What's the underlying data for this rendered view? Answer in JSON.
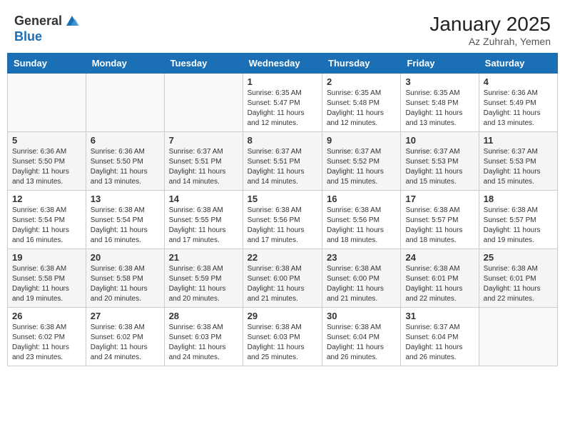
{
  "header": {
    "logo_general": "General",
    "logo_blue": "Blue",
    "month_title": "January 2025",
    "location": "Az Zuhrah, Yemen"
  },
  "days_of_week": [
    "Sunday",
    "Monday",
    "Tuesday",
    "Wednesday",
    "Thursday",
    "Friday",
    "Saturday"
  ],
  "weeks": [
    [
      {
        "day": "",
        "info": ""
      },
      {
        "day": "",
        "info": ""
      },
      {
        "day": "",
        "info": ""
      },
      {
        "day": "1",
        "info": "Sunrise: 6:35 AM\nSunset: 5:47 PM\nDaylight: 11 hours and 12 minutes."
      },
      {
        "day": "2",
        "info": "Sunrise: 6:35 AM\nSunset: 5:48 PM\nDaylight: 11 hours and 12 minutes."
      },
      {
        "day": "3",
        "info": "Sunrise: 6:35 AM\nSunset: 5:48 PM\nDaylight: 11 hours and 13 minutes."
      },
      {
        "day": "4",
        "info": "Sunrise: 6:36 AM\nSunset: 5:49 PM\nDaylight: 11 hours and 13 minutes."
      }
    ],
    [
      {
        "day": "5",
        "info": "Sunrise: 6:36 AM\nSunset: 5:50 PM\nDaylight: 11 hours and 13 minutes."
      },
      {
        "day": "6",
        "info": "Sunrise: 6:36 AM\nSunset: 5:50 PM\nDaylight: 11 hours and 13 minutes."
      },
      {
        "day": "7",
        "info": "Sunrise: 6:37 AM\nSunset: 5:51 PM\nDaylight: 11 hours and 14 minutes."
      },
      {
        "day": "8",
        "info": "Sunrise: 6:37 AM\nSunset: 5:51 PM\nDaylight: 11 hours and 14 minutes."
      },
      {
        "day": "9",
        "info": "Sunrise: 6:37 AM\nSunset: 5:52 PM\nDaylight: 11 hours and 15 minutes."
      },
      {
        "day": "10",
        "info": "Sunrise: 6:37 AM\nSunset: 5:53 PM\nDaylight: 11 hours and 15 minutes."
      },
      {
        "day": "11",
        "info": "Sunrise: 6:37 AM\nSunset: 5:53 PM\nDaylight: 11 hours and 15 minutes."
      }
    ],
    [
      {
        "day": "12",
        "info": "Sunrise: 6:38 AM\nSunset: 5:54 PM\nDaylight: 11 hours and 16 minutes."
      },
      {
        "day": "13",
        "info": "Sunrise: 6:38 AM\nSunset: 5:54 PM\nDaylight: 11 hours and 16 minutes."
      },
      {
        "day": "14",
        "info": "Sunrise: 6:38 AM\nSunset: 5:55 PM\nDaylight: 11 hours and 17 minutes."
      },
      {
        "day": "15",
        "info": "Sunrise: 6:38 AM\nSunset: 5:56 PM\nDaylight: 11 hours and 17 minutes."
      },
      {
        "day": "16",
        "info": "Sunrise: 6:38 AM\nSunset: 5:56 PM\nDaylight: 11 hours and 18 minutes."
      },
      {
        "day": "17",
        "info": "Sunrise: 6:38 AM\nSunset: 5:57 PM\nDaylight: 11 hours and 18 minutes."
      },
      {
        "day": "18",
        "info": "Sunrise: 6:38 AM\nSunset: 5:57 PM\nDaylight: 11 hours and 19 minutes."
      }
    ],
    [
      {
        "day": "19",
        "info": "Sunrise: 6:38 AM\nSunset: 5:58 PM\nDaylight: 11 hours and 19 minutes."
      },
      {
        "day": "20",
        "info": "Sunrise: 6:38 AM\nSunset: 5:58 PM\nDaylight: 11 hours and 20 minutes."
      },
      {
        "day": "21",
        "info": "Sunrise: 6:38 AM\nSunset: 5:59 PM\nDaylight: 11 hours and 20 minutes."
      },
      {
        "day": "22",
        "info": "Sunrise: 6:38 AM\nSunset: 6:00 PM\nDaylight: 11 hours and 21 minutes."
      },
      {
        "day": "23",
        "info": "Sunrise: 6:38 AM\nSunset: 6:00 PM\nDaylight: 11 hours and 21 minutes."
      },
      {
        "day": "24",
        "info": "Sunrise: 6:38 AM\nSunset: 6:01 PM\nDaylight: 11 hours and 22 minutes."
      },
      {
        "day": "25",
        "info": "Sunrise: 6:38 AM\nSunset: 6:01 PM\nDaylight: 11 hours and 22 minutes."
      }
    ],
    [
      {
        "day": "26",
        "info": "Sunrise: 6:38 AM\nSunset: 6:02 PM\nDaylight: 11 hours and 23 minutes."
      },
      {
        "day": "27",
        "info": "Sunrise: 6:38 AM\nSunset: 6:02 PM\nDaylight: 11 hours and 24 minutes."
      },
      {
        "day": "28",
        "info": "Sunrise: 6:38 AM\nSunset: 6:03 PM\nDaylight: 11 hours and 24 minutes."
      },
      {
        "day": "29",
        "info": "Sunrise: 6:38 AM\nSunset: 6:03 PM\nDaylight: 11 hours and 25 minutes."
      },
      {
        "day": "30",
        "info": "Sunrise: 6:38 AM\nSunset: 6:04 PM\nDaylight: 11 hours and 26 minutes."
      },
      {
        "day": "31",
        "info": "Sunrise: 6:37 AM\nSunset: 6:04 PM\nDaylight: 11 hours and 26 minutes."
      },
      {
        "day": "",
        "info": ""
      }
    ]
  ]
}
